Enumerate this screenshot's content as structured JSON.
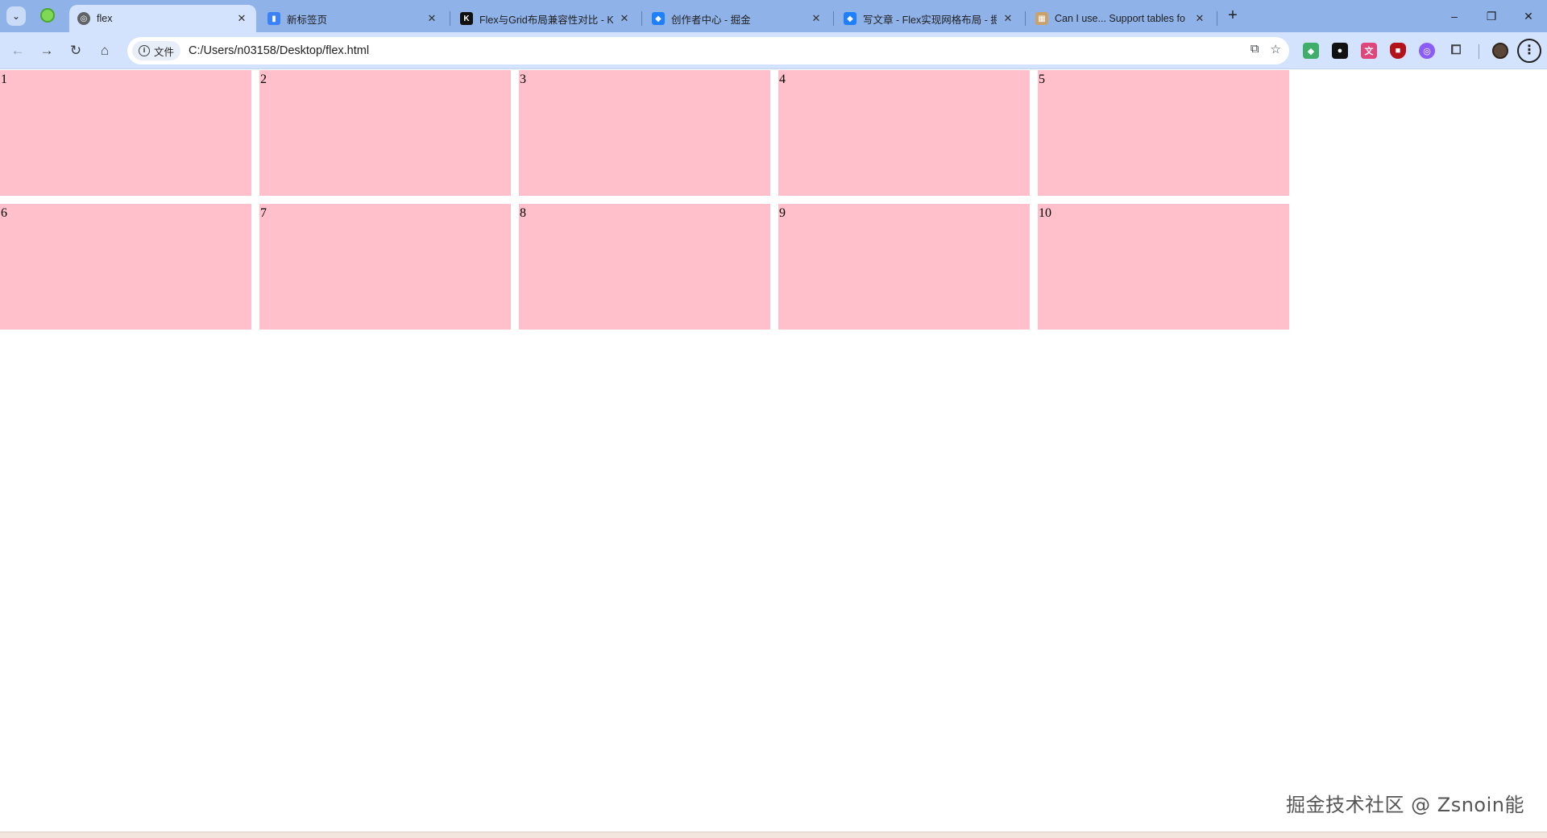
{
  "browser": {
    "tabs": [
      {
        "title": "flex",
        "active": true,
        "favicon": "globe-icon"
      },
      {
        "title": "新标签页",
        "active": false,
        "favicon": "newtab-icon"
      },
      {
        "title": "Flex与Grid布局兼容性对比 - K",
        "active": false,
        "favicon": "k-logo-icon"
      },
      {
        "title": "创作者中心 - 掘金",
        "active": false,
        "favicon": "juejin-icon"
      },
      {
        "title": "写文章 - Flex实现网格布局 - 掘",
        "active": false,
        "favicon": "juejin-icon"
      },
      {
        "title": "Can I use... Support tables fo",
        "active": false,
        "favicon": "caniuse-icon"
      }
    ],
    "new_tab_glyph": "+",
    "window_controls": {
      "minimize": "–",
      "restore": "❐",
      "close": "✕"
    }
  },
  "toolbar": {
    "security_chip_label": "文件",
    "url": "C:/Users/n03158/Desktop/flex.html"
  },
  "page": {
    "items": [
      "1",
      "2",
      "3",
      "4",
      "5",
      "6",
      "7",
      "8",
      "9",
      "10"
    ],
    "item_color": "#ffc0cb",
    "watermark": "掘金技术社区 @ Zsnoin能"
  }
}
